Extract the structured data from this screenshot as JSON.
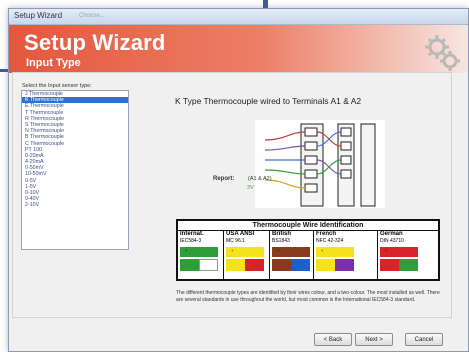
{
  "window": {
    "title": "Setup Wizard",
    "ghost_tab": "Choose..."
  },
  "banner": {
    "title": "Setup Wizard",
    "subtitle": "Input Type",
    "gear_icon": "gears-icon"
  },
  "sensor_list": {
    "label": "Select the Input sensor type:",
    "items": [
      "J Thermocouple",
      "K Thermocouple",
      "E Thermocouple",
      "T Thermocouple",
      "R Thermocouple",
      "S Thermocouple",
      "N Thermocouple",
      "B Thermocouple",
      "C Thermocouple",
      "PT 100",
      "0-20mA",
      "4-20mA",
      "0-50mV",
      "10-50mV",
      "0-5V",
      "1-5V",
      "0-10V",
      "0-40V",
      "2-10V"
    ],
    "selected_index": 1
  },
  "detail": {
    "description": "K Type Thermocouple wired to Terminals A1 & A2",
    "report_label": "Report:",
    "report_terminals": "(A1 & A2)",
    "report_extra": "3V"
  },
  "wire_table": {
    "title": "Thermocouple Wire Identification",
    "columns": [
      {
        "name": "Internat.",
        "code": "IEC584-3",
        "plus_color": "#2e9d3a",
        "minus_color": "#ffffff"
      },
      {
        "name": "USA ANSI",
        "code": "MC 96.1",
        "plus_color": "#f5e21a",
        "minus_color": "#d8232a"
      },
      {
        "name": "British",
        "code": "BS1843",
        "plus_color": "#8a3b1e",
        "minus_color": "#1c5fd0"
      },
      {
        "name": "French",
        "code": "NFC 42-324",
        "plus_color": "#f5e21a",
        "minus_color": "#7a2fb0"
      },
      {
        "name": "German",
        "code": "DIN 43710",
        "plus_color": "#d8232a",
        "minus_color": "#2e9d3a"
      }
    ]
  },
  "note": "The different thermocouple types are identified by their wires colour, and a two-colour. The most installed as well. There are several standards in use throughout the world, but most common is the International IEC584-3 standard.",
  "buttons": {
    "back": "< Back",
    "next": "Next >",
    "cancel": "Cancel"
  }
}
